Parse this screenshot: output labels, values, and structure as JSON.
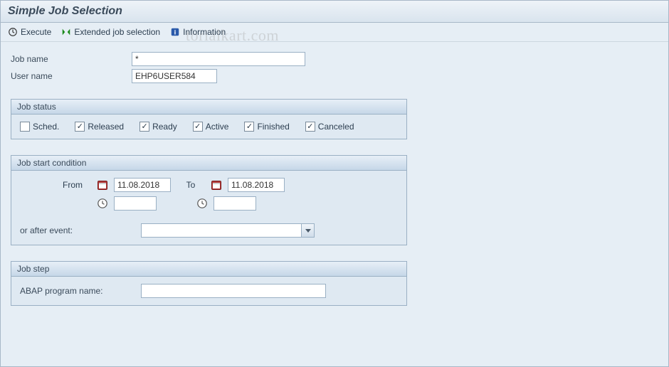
{
  "title": "Simple Job Selection",
  "watermark": "torialkart.com",
  "toolbar": {
    "execute": "Execute",
    "extended": "Extended job selection",
    "info": "Information"
  },
  "fields": {
    "job_name_label": "Job name",
    "job_name_value": "*",
    "user_name_label": "User name",
    "user_name_value": "EHP6USER584"
  },
  "status": {
    "title": "Job status",
    "sched": "Sched.",
    "released": "Released",
    "ready": "Ready",
    "active": "Active",
    "finished": "Finished",
    "canceled": "Canceled"
  },
  "start": {
    "title": "Job start condition",
    "from": "From",
    "to": "To",
    "from_date": "11.08.2018",
    "to_date": "11.08.2018",
    "from_time": "",
    "to_time": "",
    "event_label": "or after event:",
    "event_value": ""
  },
  "step": {
    "title": "Job step",
    "abap_label": "ABAP program name:",
    "abap_value": ""
  }
}
